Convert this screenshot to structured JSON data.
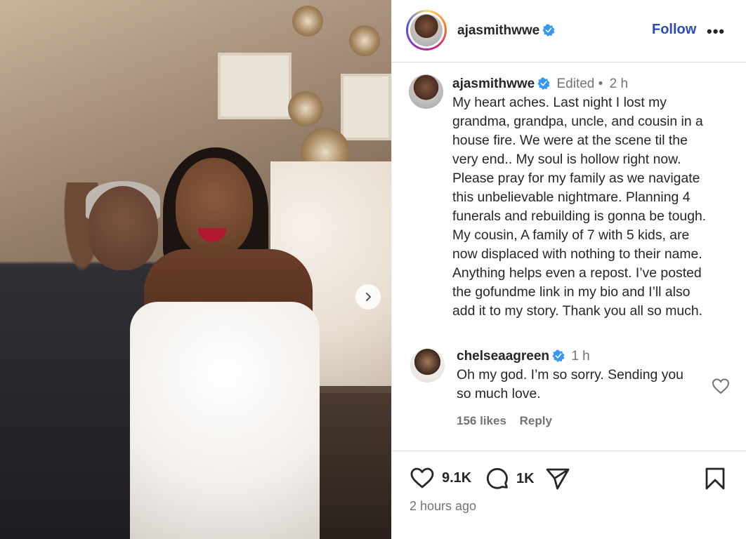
{
  "post": {
    "author": "ajasmithwwe",
    "follow_label": "Follow",
    "more_label": "•••"
  },
  "caption": {
    "author": "ajasmithwwe",
    "edited_label": "Edited •",
    "time": "2 h",
    "text": "My heart aches. Last night I lost my\ngrandma, grandpa, uncle, and cousin in a\nhouse fire. We were at the scene til the\nvery end.. My soul is hollow right now.\nPlease pray for my family as we navigate\nthis unbelievable nightmare. Planning 4\nfunerals and rebuilding is gonna be tough.\nMy cousin, A family of 7 with 5 kids, are\nnow displaced with nothing to their name.\nAnything helps even a repost. I’ve posted\nthe gofundme link in my bio and I’ll also\nadd it to my story. Thank you all so much."
  },
  "comment": {
    "author": "chelseaagreen",
    "time": "1 h",
    "text_line1": "Oh my god. I’m so sorry. Sending you",
    "text_line2": "so much love.",
    "likes": "156 likes",
    "reply_label": "Reply"
  },
  "actions": {
    "likes": "9.1K",
    "comments": "1K",
    "posted": "2 hours ago"
  },
  "colors": {
    "verified": "#3897f0",
    "follow": "#2b4ab8",
    "muted": "#737373"
  }
}
